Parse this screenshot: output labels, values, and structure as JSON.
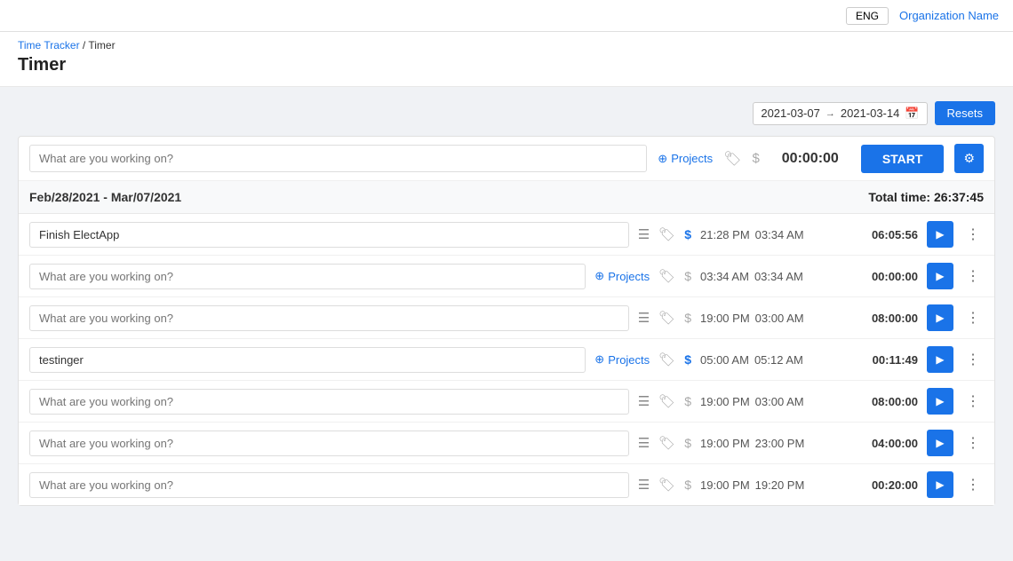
{
  "topbar": {
    "lang_label": "ENG",
    "org_name": "Organization Name"
  },
  "header": {
    "breadcrumb_link": "Time Tracker",
    "breadcrumb_separator": "/",
    "breadcrumb_current": "Timer",
    "page_title": "Timer"
  },
  "date_range": {
    "start": "2021-03-07",
    "arrow": "→",
    "end": "2021-03-14",
    "reset_label": "Resets"
  },
  "timer_input": {
    "placeholder": "What are you working on?",
    "projects_label": "Projects",
    "timer_value": "00:00:00",
    "start_label": "START"
  },
  "period": {
    "label": "Feb/28/2021 - Mar/07/2021",
    "total_label": "Total time: 26:37:45"
  },
  "entries": [
    {
      "description": "Finish ElectApp",
      "has_description": true,
      "has_projects": false,
      "projects_label": "",
      "dollar_active": true,
      "start_time": "21:28 PM",
      "end_time": "03:34 AM",
      "duration": "06:05:56"
    },
    {
      "description": "What are you working on?",
      "has_description": false,
      "has_projects": true,
      "projects_label": "Projects",
      "dollar_active": false,
      "start_time": "03:34 AM",
      "end_time": "03:34 AM",
      "duration": "00:00:00"
    },
    {
      "description": "What are you working on?",
      "has_description": false,
      "has_projects": false,
      "projects_label": "",
      "dollar_active": false,
      "start_time": "19:00 PM",
      "end_time": "03:00 AM",
      "duration": "08:00:00"
    },
    {
      "description": "testinger",
      "has_description": true,
      "has_projects": true,
      "projects_label": "Projects",
      "dollar_active": true,
      "start_time": "05:00 AM",
      "end_time": "05:12 AM",
      "duration": "00:11:49"
    },
    {
      "description": "What are you working on?",
      "has_description": false,
      "has_projects": false,
      "projects_label": "",
      "dollar_active": false,
      "start_time": "19:00 PM",
      "end_time": "03:00 AM",
      "duration": "08:00:00"
    },
    {
      "description": "What are you working on?",
      "has_description": false,
      "has_projects": false,
      "projects_label": "",
      "dollar_active": false,
      "start_time": "19:00 PM",
      "end_time": "23:00 PM",
      "duration": "04:00:00"
    },
    {
      "description": "What are you working on?",
      "has_description": false,
      "has_projects": false,
      "projects_label": "",
      "dollar_active": false,
      "start_time": "19:00 PM",
      "end_time": "19:20 PM",
      "duration": "00:20:00"
    }
  ]
}
